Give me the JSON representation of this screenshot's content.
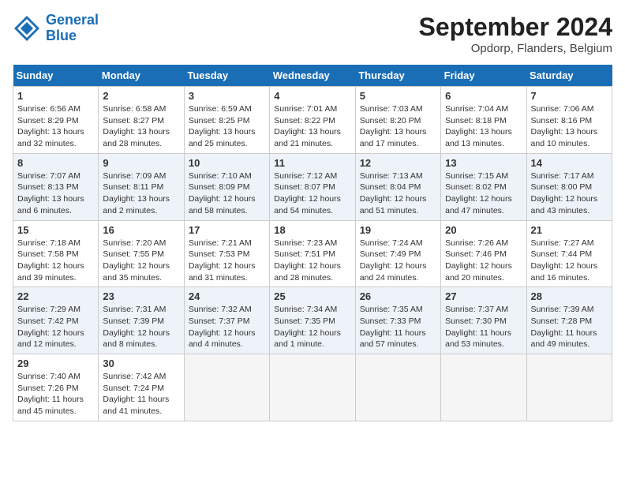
{
  "header": {
    "logo_line1": "General",
    "logo_line2": "Blue",
    "month": "September 2024",
    "location": "Opdorp, Flanders, Belgium"
  },
  "days_of_week": [
    "Sunday",
    "Monday",
    "Tuesday",
    "Wednesday",
    "Thursday",
    "Friday",
    "Saturday"
  ],
  "weeks": [
    [
      {
        "num": "1",
        "rise": "6:56 AM",
        "set": "8:29 PM",
        "daylight": "13 hours and 32 minutes."
      },
      {
        "num": "2",
        "rise": "6:58 AM",
        "set": "8:27 PM",
        "daylight": "13 hours and 28 minutes."
      },
      {
        "num": "3",
        "rise": "6:59 AM",
        "set": "8:25 PM",
        "daylight": "13 hours and 25 minutes."
      },
      {
        "num": "4",
        "rise": "7:01 AM",
        "set": "8:22 PM",
        "daylight": "13 hours and 21 minutes."
      },
      {
        "num": "5",
        "rise": "7:03 AM",
        "set": "8:20 PM",
        "daylight": "13 hours and 17 minutes."
      },
      {
        "num": "6",
        "rise": "7:04 AM",
        "set": "8:18 PM",
        "daylight": "13 hours and 13 minutes."
      },
      {
        "num": "7",
        "rise": "7:06 AM",
        "set": "8:16 PM",
        "daylight": "13 hours and 10 minutes."
      }
    ],
    [
      {
        "num": "8",
        "rise": "7:07 AM",
        "set": "8:13 PM",
        "daylight": "13 hours and 6 minutes."
      },
      {
        "num": "9",
        "rise": "7:09 AM",
        "set": "8:11 PM",
        "daylight": "13 hours and 2 minutes."
      },
      {
        "num": "10",
        "rise": "7:10 AM",
        "set": "8:09 PM",
        "daylight": "12 hours and 58 minutes."
      },
      {
        "num": "11",
        "rise": "7:12 AM",
        "set": "8:07 PM",
        "daylight": "12 hours and 54 minutes."
      },
      {
        "num": "12",
        "rise": "7:13 AM",
        "set": "8:04 PM",
        "daylight": "12 hours and 51 minutes."
      },
      {
        "num": "13",
        "rise": "7:15 AM",
        "set": "8:02 PM",
        "daylight": "12 hours and 47 minutes."
      },
      {
        "num": "14",
        "rise": "7:17 AM",
        "set": "8:00 PM",
        "daylight": "12 hours and 43 minutes."
      }
    ],
    [
      {
        "num": "15",
        "rise": "7:18 AM",
        "set": "7:58 PM",
        "daylight": "12 hours and 39 minutes."
      },
      {
        "num": "16",
        "rise": "7:20 AM",
        "set": "7:55 PM",
        "daylight": "12 hours and 35 minutes."
      },
      {
        "num": "17",
        "rise": "7:21 AM",
        "set": "7:53 PM",
        "daylight": "12 hours and 31 minutes."
      },
      {
        "num": "18",
        "rise": "7:23 AM",
        "set": "7:51 PM",
        "daylight": "12 hours and 28 minutes."
      },
      {
        "num": "19",
        "rise": "7:24 AM",
        "set": "7:49 PM",
        "daylight": "12 hours and 24 minutes."
      },
      {
        "num": "20",
        "rise": "7:26 AM",
        "set": "7:46 PM",
        "daylight": "12 hours and 20 minutes."
      },
      {
        "num": "21",
        "rise": "7:27 AM",
        "set": "7:44 PM",
        "daylight": "12 hours and 16 minutes."
      }
    ],
    [
      {
        "num": "22",
        "rise": "7:29 AM",
        "set": "7:42 PM",
        "daylight": "12 hours and 12 minutes."
      },
      {
        "num": "23",
        "rise": "7:31 AM",
        "set": "7:39 PM",
        "daylight": "12 hours and 8 minutes."
      },
      {
        "num": "24",
        "rise": "7:32 AM",
        "set": "7:37 PM",
        "daylight": "12 hours and 4 minutes."
      },
      {
        "num": "25",
        "rise": "7:34 AM",
        "set": "7:35 PM",
        "daylight": "12 hours and 1 minute."
      },
      {
        "num": "26",
        "rise": "7:35 AM",
        "set": "7:33 PM",
        "daylight": "11 hours and 57 minutes."
      },
      {
        "num": "27",
        "rise": "7:37 AM",
        "set": "7:30 PM",
        "daylight": "11 hours and 53 minutes."
      },
      {
        "num": "28",
        "rise": "7:39 AM",
        "set": "7:28 PM",
        "daylight": "11 hours and 49 minutes."
      }
    ],
    [
      {
        "num": "29",
        "rise": "7:40 AM",
        "set": "7:26 PM",
        "daylight": "11 hours and 45 minutes."
      },
      {
        "num": "30",
        "rise": "7:42 AM",
        "set": "7:24 PM",
        "daylight": "11 hours and 41 minutes."
      },
      null,
      null,
      null,
      null,
      null
    ]
  ]
}
